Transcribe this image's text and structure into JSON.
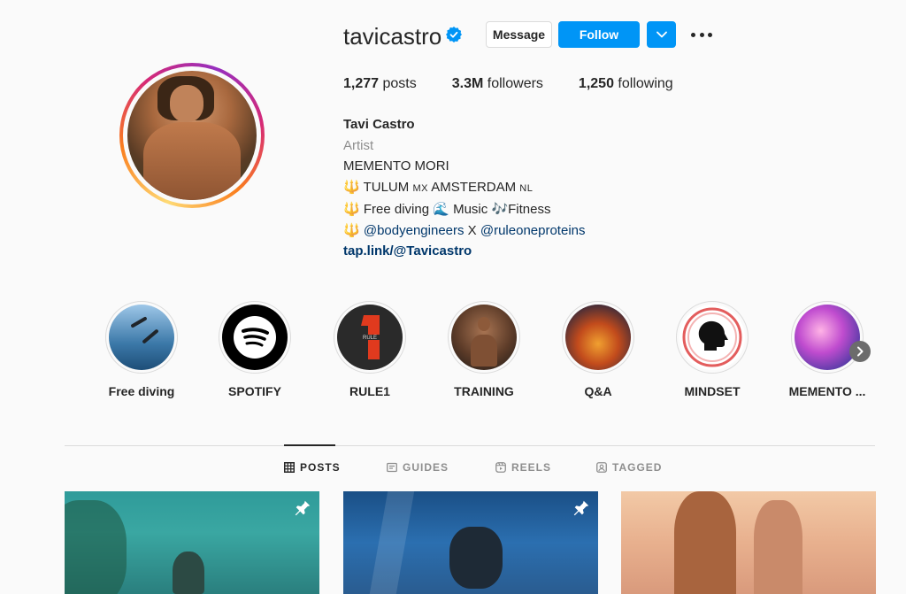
{
  "profile": {
    "username": "tavicastro",
    "verified": true,
    "actions": {
      "message_label": "Message",
      "follow_label": "Follow",
      "dropdown_icon": "chevron-down-icon",
      "more_icon": "more-horizontal-icon"
    },
    "stats": {
      "posts_count": "1,277",
      "posts_label": "posts",
      "followers_count": "3.3M",
      "followers_label": "followers",
      "following_count": "1,250",
      "following_label": "following"
    },
    "bio": {
      "name": "Tavi Castro",
      "category": "Artist",
      "line1": "MEMENTO MORI",
      "line2_a": "TULUM",
      "line2_mx": "MX",
      "line2_b": "AMSTERDAM",
      "line2_nl": "NL",
      "line3_a": "Free diving",
      "line3_b": "Music",
      "line3_c": "Fitness",
      "mention1": "@bodyengineers",
      "line4_x": "X",
      "mention2": "@ruleoneproteins",
      "link": "tap.link/@Tavicastro"
    }
  },
  "highlights": [
    {
      "label": "Free diving"
    },
    {
      "label": "SPOTIFY"
    },
    {
      "label": "RULE1"
    },
    {
      "label": "TRAINING"
    },
    {
      "label": "Q&A"
    },
    {
      "label": "MINDSET"
    },
    {
      "label": "MEMENTO ..."
    }
  ],
  "tabs": {
    "posts": "POSTS",
    "guides": "GUIDES",
    "reels": "REELS",
    "tagged": "TAGGED"
  },
  "colors": {
    "primary_blue": "#0095f6",
    "text": "#262626",
    "muted": "#8e8e8e",
    "link": "#00376b",
    "background": "#fafafa"
  }
}
